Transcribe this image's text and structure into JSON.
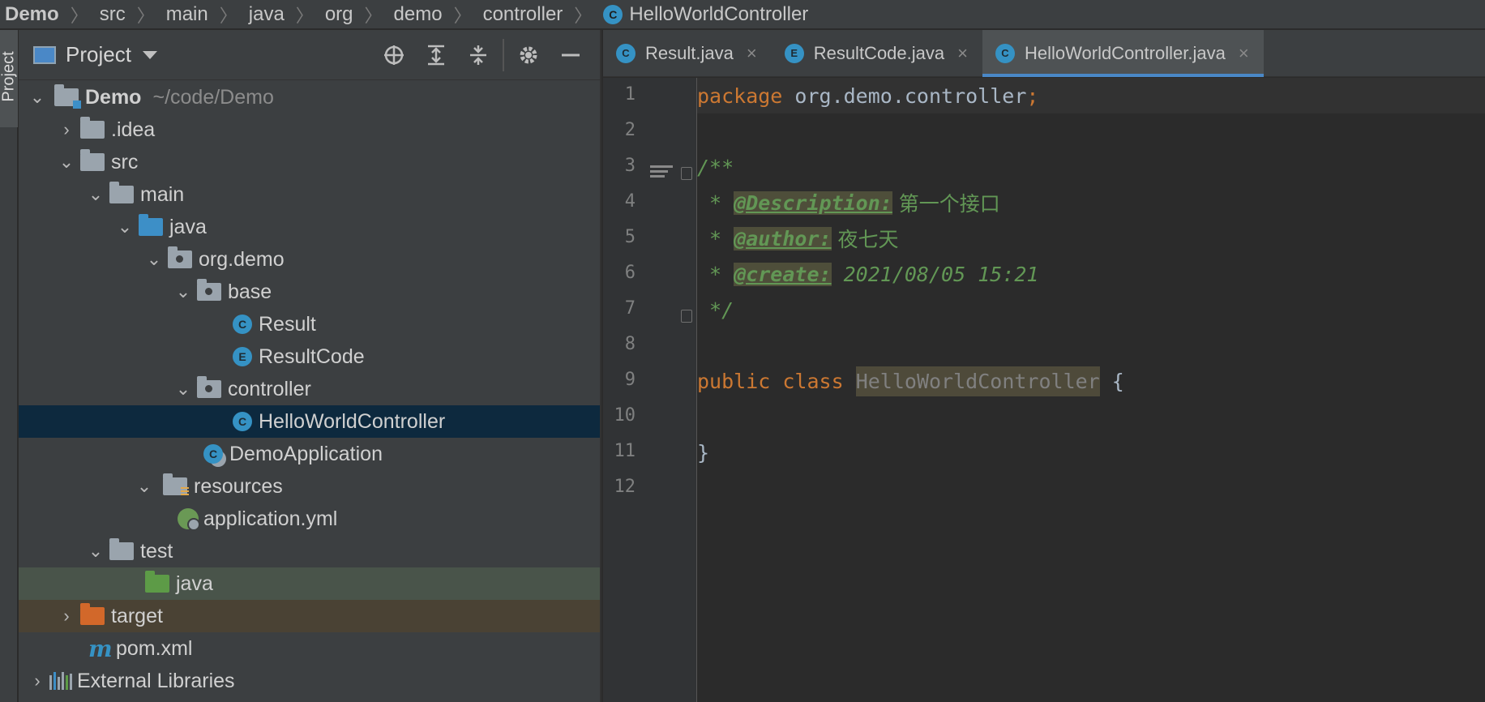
{
  "breadcrumb": [
    "Demo",
    "src",
    "main",
    "java",
    "org",
    "demo",
    "controller",
    "HelloWorldController"
  ],
  "breadcrumb_last_icon": "C",
  "toolstrip": {
    "project_tab_label": "Project"
  },
  "project_panel": {
    "title": "Project",
    "tools": [
      "locate-icon",
      "expand-all-icon",
      "collapse-all-icon",
      "settings-icon",
      "hide-icon"
    ]
  },
  "tree": [
    {
      "label": "Demo",
      "path": "~/code/Demo"
    },
    {
      "label": ".idea"
    },
    {
      "label": "src"
    },
    {
      "label": "main"
    },
    {
      "label": "java"
    },
    {
      "label": "org.demo"
    },
    {
      "label": "base"
    },
    {
      "label": "Result",
      "icon_letter": "C"
    },
    {
      "label": "ResultCode",
      "icon_letter": "E"
    },
    {
      "label": "controller"
    },
    {
      "label": "HelloWorldController",
      "icon_letter": "C"
    },
    {
      "label": "DemoApplication",
      "icon_letter": "C"
    },
    {
      "label": "resources"
    },
    {
      "label": "application.yml"
    },
    {
      "label": "test"
    },
    {
      "label": "java"
    },
    {
      "label": "target"
    },
    {
      "label": "pom.xml",
      "icon_letter": "m"
    },
    {
      "label": "External Libraries"
    }
  ],
  "tabs": [
    {
      "label": "Result.java",
      "icon_letter": "C"
    },
    {
      "label": "ResultCode.java",
      "icon_letter": "E"
    },
    {
      "label": "HelloWorldController.java",
      "icon_letter": "C"
    }
  ],
  "close_glyph": "×",
  "line_numbers": [
    "1",
    "2",
    "3",
    "4",
    "5",
    "6",
    "7",
    "8",
    "9",
    "10",
    "11",
    "12"
  ],
  "code": {
    "l1_kw": "package",
    "l1_rest": " org.demo.controller",
    "l1_semi": ";",
    "l3": "/**",
    "l4_star": " * ",
    "l4_tag": "@Description:",
    "l4_text": " 第一个接口",
    "l5_star": " * ",
    "l5_tag": "@author:",
    "l5_text": " 夜七天",
    "l6_star": " * ",
    "l6_tag": "@create:",
    "l6_text": " 2021/08/05 15:21",
    "l7": " */",
    "l9_kw1": "public",
    "l9_kw2": "class",
    "l9_name": "HelloWorldController",
    "l9_brace": " {",
    "l11": "}"
  },
  "colors": {
    "keyword": "#cc7832",
    "comment": "#629755",
    "text": "#a9b7c6",
    "selection": "#0d293e",
    "accent": "#4a88c7"
  }
}
